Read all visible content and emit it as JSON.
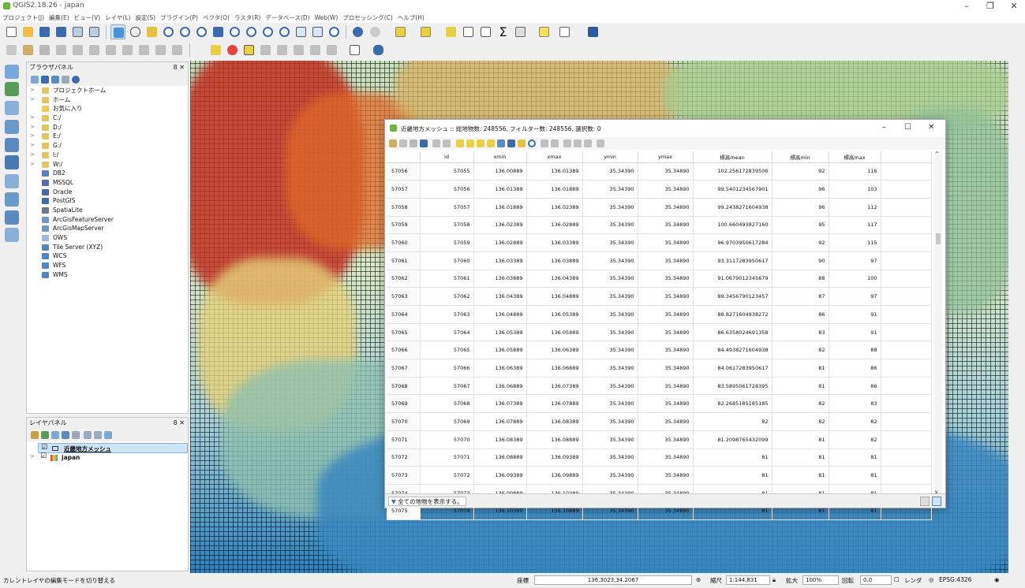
{
  "app": {
    "title": "QGIS2.18.26 - japan",
    "window_controls": [
      "–",
      "❐",
      "✕"
    ]
  },
  "menubar": [
    "プロジェクト(J)",
    "編集(E)",
    "ビュー(V)",
    "レイヤ(L)",
    "設定(S)",
    "プラグイン(P)",
    "ベクタ(O)",
    "ラスタ(R)",
    "データベース(D)",
    "Web(W)",
    "プロセッシング(C)",
    "ヘルプ(H)"
  ],
  "browser_panel": {
    "title": "ブラウザパネル",
    "close": "8 ✕",
    "items": [
      {
        "label": "プロジェクトホーム",
        "arrow": ">",
        "color": "#e7c45a"
      },
      {
        "label": "ホーム",
        "arrow": ">",
        "color": "#e7c45a"
      },
      {
        "label": "お気に入り",
        "arrow": "",
        "color": "#f2c94c"
      },
      {
        "label": "C:/",
        "arrow": ">",
        "color": "#e7c45a"
      },
      {
        "label": "D:/",
        "arrow": ">",
        "color": "#e7c45a"
      },
      {
        "label": "E:/",
        "arrow": ">",
        "color": "#e7c45a"
      },
      {
        "label": "G:/",
        "arrow": ">",
        "color": "#e7c45a"
      },
      {
        "label": "I:/",
        "arrow": ">",
        "color": "#e7c45a"
      },
      {
        "label": "W:/",
        "arrow": ">",
        "color": "#e7c45a"
      },
      {
        "label": "DB2",
        "arrow": "",
        "color": "#5b7fc7"
      },
      {
        "label": "MSSQL",
        "arrow": "",
        "color": "#5a6fa8"
      },
      {
        "label": "Oracle",
        "arrow": "",
        "color": "#4a68a8"
      },
      {
        "label": "PostGIS",
        "arrow": "",
        "color": "#3a6fb0"
      },
      {
        "label": "SpatiaLite",
        "arrow": "",
        "color": "#6a7a8a"
      },
      {
        "label": "ArcGisFeatureServer",
        "arrow": "",
        "color": "#6a98c8"
      },
      {
        "label": "ArcGisMapServer",
        "arrow": "",
        "color": "#6a98c8"
      },
      {
        "label": "OWS",
        "arrow": "",
        "color": "#9ab8d8"
      },
      {
        "label": "Tile Server (XYZ)",
        "arrow": "",
        "color": "#4a88c8"
      },
      {
        "label": "WCS",
        "arrow": "",
        "color": "#4a88c8"
      },
      {
        "label": "WFS",
        "arrow": "",
        "color": "#4a88c8"
      },
      {
        "label": "WMS",
        "arrow": "",
        "color": "#4a88c8"
      }
    ]
  },
  "layers_panel": {
    "title": "レイヤパネル",
    "close": "8 ✕",
    "layers": [
      {
        "label": "近畿地方メッシュ",
        "checked": "☑",
        "selected": true
      },
      {
        "label": "japan",
        "checked": "☑",
        "selected": false
      }
    ]
  },
  "attribute_table": {
    "title": "近畿地方メッシュ :: 総地物数: 248556, フィルター数: 248556, 選択数: 0",
    "columns": [
      "id",
      "xmin",
      "xmax",
      "ymin",
      "ymax",
      "標高mean",
      "標高min",
      "標高max"
    ],
    "rows": [
      [
        "57056",
        "57055",
        "136.00889",
        "136.01389",
        "35.34390",
        "35.34890",
        "102.256172839506",
        "92",
        "116"
      ],
      [
        "57057",
        "57056",
        "136.01389",
        "136.01889",
        "35.34390",
        "35.34890",
        "99.5401234567901",
        "96",
        "103"
      ],
      [
        "57058",
        "57057",
        "136.01889",
        "136.02389",
        "35.34390",
        "35.34890",
        "99.2438271604938",
        "96",
        "112"
      ],
      [
        "57059",
        "57058",
        "136.02389",
        "136.02889",
        "35.34390",
        "35.34890",
        "100.660493827160",
        "95",
        "117"
      ],
      [
        "57060",
        "57059",
        "136.02889",
        "136.03389",
        "35.34390",
        "35.34890",
        "96.9703950617284",
        "92",
        "115"
      ],
      [
        "57061",
        "57060",
        "136.03389",
        "136.03889",
        "35.34390",
        "35.34890",
        "93.3117283950617",
        "90",
        "97"
      ],
      [
        "57062",
        "57061",
        "136.03889",
        "136.04389",
        "35.34390",
        "35.34890",
        "91.0679012345679",
        "88",
        "100"
      ],
      [
        "57063",
        "57062",
        "136.04389",
        "136.04889",
        "35.34390",
        "35.34890",
        "89.3456790123457",
        "87",
        "97"
      ],
      [
        "57064",
        "57063",
        "136.04889",
        "136.05389",
        "35.34390",
        "35.34890",
        "88.8271604938272",
        "86",
        "91"
      ],
      [
        "57065",
        "57064",
        "136.05389",
        "136.05889",
        "35.34390",
        "35.34890",
        "86.6358024691358",
        "83",
        "91"
      ],
      [
        "57066",
        "57065",
        "136.05889",
        "136.06389",
        "35.34390",
        "35.34890",
        "84.4938271604938",
        "82",
        "88"
      ],
      [
        "57067",
        "57066",
        "136.06389",
        "136.06889",
        "35.34390",
        "35.34890",
        "84.0617283950617",
        "81",
        "86"
      ],
      [
        "57068",
        "57067",
        "136.06889",
        "136.07389",
        "35.34390",
        "35.34890",
        "83.5895061728395",
        "81",
        "86"
      ],
      [
        "57069",
        "57068",
        "136.07389",
        "136.07889",
        "35.34390",
        "35.34890",
        "82.2685185185185",
        "82",
        "83"
      ],
      [
        "57070",
        "57069",
        "136.07889",
        "136.08389",
        "35.34390",
        "35.34890",
        "82",
        "82",
        "82"
      ],
      [
        "57071",
        "57070",
        "136.08389",
        "136.08889",
        "35.34390",
        "35.34890",
        "81.2098765432099",
        "81",
        "82"
      ],
      [
        "57072",
        "57071",
        "136.08889",
        "136.09389",
        "35.34390",
        "35.34890",
        "81",
        "81",
        "81"
      ],
      [
        "57073",
        "57072",
        "136.09389",
        "136.09889",
        "35.34390",
        "35.34890",
        "81",
        "81",
        "81"
      ],
      [
        "57074",
        "57073",
        "136.09889",
        "136.10389",
        "35.34390",
        "35.34890",
        "81",
        "81",
        "81"
      ],
      [
        "57075",
        "57074",
        "136.10389",
        "136.10889",
        "35.34390",
        "35.34890",
        "81",
        "81",
        "81"
      ]
    ],
    "footer_button": "全ての地物を表示する。",
    "window_controls": [
      "–",
      "☐",
      "✕"
    ]
  },
  "statusbar": {
    "message": "カレントレイヤの編集モードを切り替える",
    "coord_label": "座標",
    "coord_value": "136.3023,34.2067",
    "scale_label": "縮尺",
    "scale_value": "1:144,831",
    "zoom_label": "拡大",
    "zoom_value": "100%",
    "rotation_label": "回転",
    "rotation_value": "0.0",
    "render_label": "レンダ",
    "crs": "EPSG:4326"
  }
}
